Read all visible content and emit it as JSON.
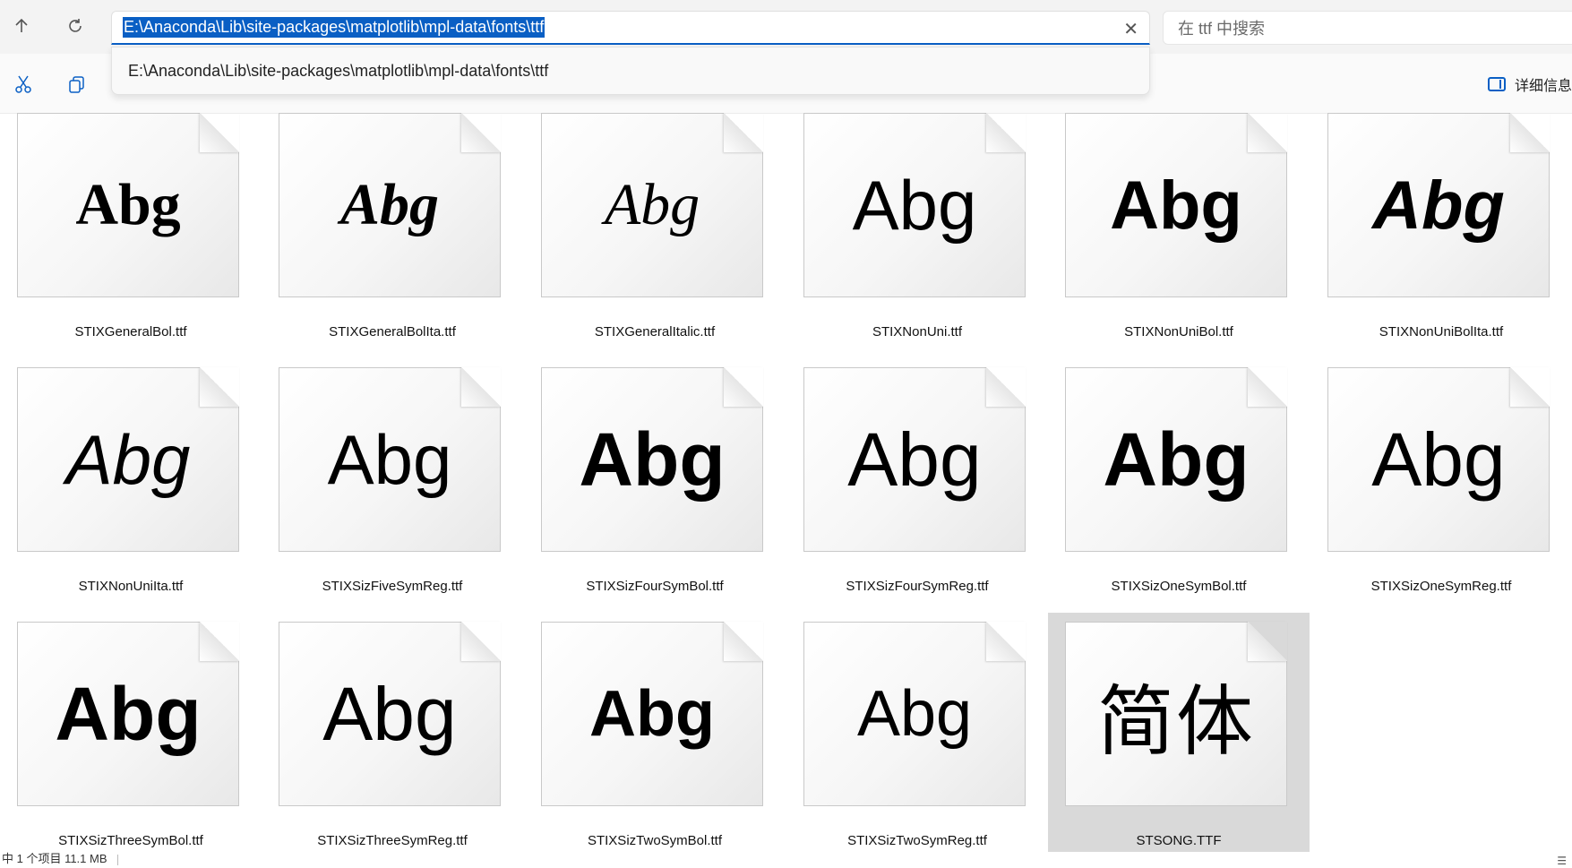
{
  "address_bar": {
    "path": "E:\\Anaconda\\Lib\\site-packages\\matplotlib\\mpl-data\\fonts\\ttf",
    "suggestion": "E:\\Anaconda\\Lib\\site-packages\\matplotlib\\mpl-data\\fonts\\ttf",
    "clear_icon": "close-icon"
  },
  "search": {
    "placeholder": "在 ttf 中搜索"
  },
  "toolbar": {
    "details_label": "详细信息",
    "cut_icon": "scissors-icon",
    "copy_icon": "copy-icon"
  },
  "preview_sample": "Abg",
  "files": [
    {
      "name": "STIXGeneralBol.ttf",
      "preview": "Abg"
    },
    {
      "name": "STIXGeneralBolIta.ttf",
      "preview": "Abg"
    },
    {
      "name": "STIXGeneralItalic.ttf",
      "preview": "Abg"
    },
    {
      "name": "STIXNonUni.ttf",
      "preview": "Abg"
    },
    {
      "name": "STIXNonUniBol.ttf",
      "preview": "Abg"
    },
    {
      "name": "STIXNonUniBolIta.ttf",
      "preview": "Abg"
    },
    {
      "name": "STIXNonUniIta.ttf",
      "preview": "Abg"
    },
    {
      "name": "STIXSizFiveSymReg.ttf",
      "preview": "Abg"
    },
    {
      "name": "STIXSizFourSymBol.ttf",
      "preview": "Abg"
    },
    {
      "name": "STIXSizFourSymReg.ttf",
      "preview": "Abg"
    },
    {
      "name": "STIXSizOneSymBol.ttf",
      "preview": "Abg"
    },
    {
      "name": "STIXSizOneSymReg.ttf",
      "preview": "Abg"
    },
    {
      "name": "STIXSizThreeSymBol.ttf",
      "preview": "Abg"
    },
    {
      "name": "STIXSizThreeSymReg.ttf",
      "preview": "Abg"
    },
    {
      "name": "STIXSizTwoSymBol.ttf",
      "preview": "Abg"
    },
    {
      "name": "STIXSizTwoSymReg.ttf",
      "preview": "Abg"
    },
    {
      "name": "STSONG.TTF",
      "preview": "简体",
      "selected": true
    }
  ],
  "status": {
    "selection": "中 1 个项目  11.1 MB"
  },
  "colors": {
    "accent": "#0a5fc4",
    "selected_tile": "#d9d9d9"
  }
}
